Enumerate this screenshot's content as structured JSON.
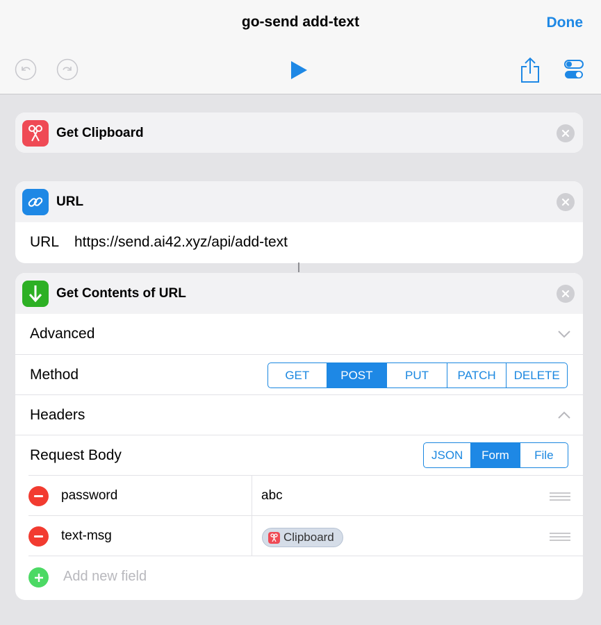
{
  "header": {
    "title": "go-send add-text",
    "done_label": "Done"
  },
  "toolbar": {
    "undo_icon": "undo-icon",
    "redo_icon": "redo-icon",
    "run_icon": "play-icon",
    "share_icon": "share-icon",
    "settings_icon": "toggle-settings-icon",
    "accent_color": "#1e88e5"
  },
  "actions": [
    {
      "title": "Get Clipboard",
      "icon": "scissors-icon",
      "icon_color": "#ef4a55"
    },
    {
      "title": "URL",
      "icon": "link-icon",
      "icon_color": "#1e88e5",
      "param_label": "URL",
      "param_value": "https://send.ai42.xyz/api/add-text"
    },
    {
      "title": "Get Contents of URL",
      "icon": "download-arrow-icon",
      "icon_color": "#2db024",
      "advanced_label": "Advanced",
      "method_label": "Method",
      "methods": [
        "GET",
        "POST",
        "PUT",
        "PATCH",
        "DELETE"
      ],
      "selected_method": "POST",
      "headers_label": "Headers",
      "body_label": "Request Body",
      "body_types": [
        "JSON",
        "Form",
        "File"
      ],
      "selected_body_type": "Form",
      "fields": [
        {
          "key": "password",
          "value": "abc"
        },
        {
          "key": "text-msg",
          "value_token": "Clipboard"
        }
      ],
      "add_field_label": "Add new field"
    }
  ]
}
